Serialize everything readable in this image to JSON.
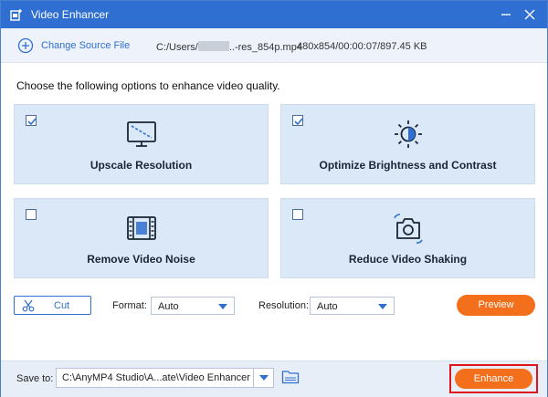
{
  "window": {
    "title": "Video Enhancer"
  },
  "filebar": {
    "change_source_label": "Change Source File",
    "file_path_prefix": "C:/Users/",
    "file_path_suffix": "..-res_854p.mp4",
    "file_info": "480x854/00:00:07/897.45 KB"
  },
  "intro": "Choose the following options to enhance video quality.",
  "options": [
    {
      "label": "Upscale Resolution",
      "checked": true,
      "icon": "monitor-upscale-icon"
    },
    {
      "label": "Optimize Brightness and Contrast",
      "checked": true,
      "icon": "brightness-icon"
    },
    {
      "label": "Remove Video Noise",
      "checked": false,
      "icon": "film-strip-icon"
    },
    {
      "label": "Reduce Video Shaking",
      "checked": false,
      "icon": "camera-stabilize-icon"
    }
  ],
  "controls": {
    "cut_label": "Cut",
    "format_label": "Format:",
    "format_value": "Auto",
    "resolution_label": "Resolution:",
    "resolution_value": "Auto",
    "preview_label": "Preview"
  },
  "footer": {
    "save_to_label": "Save to:",
    "save_path": "C:\\AnyMP4 Studio\\A...ate\\Video Enhancer",
    "enhance_label": "Enhance"
  },
  "colors": {
    "accent": "#2f6fd1",
    "action": "#f46f1c",
    "highlight": "#e0141e",
    "card": "#dbe8f8"
  }
}
